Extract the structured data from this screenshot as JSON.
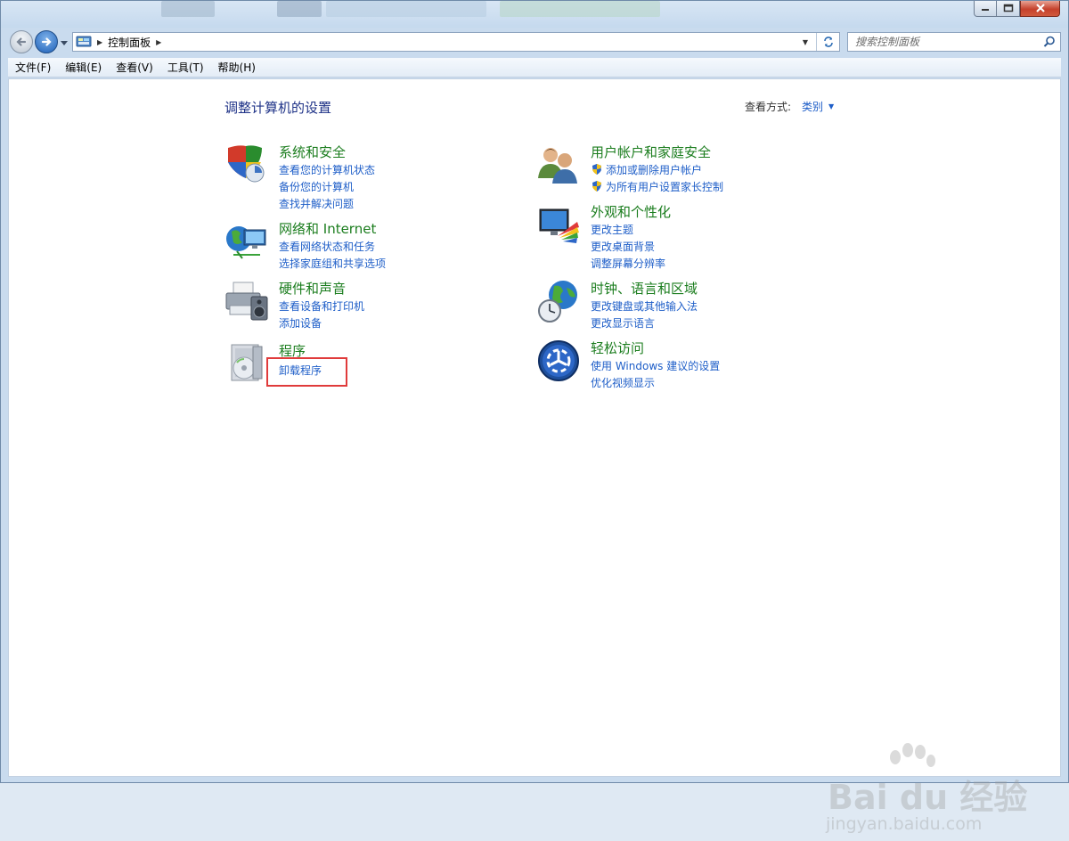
{
  "window": {
    "controls": {
      "minimize": "minimize",
      "maximize": "maximize",
      "close": "close"
    }
  },
  "address": {
    "breadcrumb": [
      "控制面板"
    ]
  },
  "search": {
    "placeholder": "搜索控制面板"
  },
  "menu": {
    "items": [
      "文件(F)",
      "编辑(E)",
      "查看(V)",
      "工具(T)",
      "帮助(H)"
    ]
  },
  "main": {
    "heading": "调整计算机的设置",
    "view_by_label": "查看方式:",
    "view_by_value": "类别",
    "categories": [
      {
        "title": "系统和安全",
        "icon": "shield-security-icon",
        "links": [
          "查看您的计算机状态",
          "备份您的计算机",
          "查找并解决问题"
        ]
      },
      {
        "title": "网络和 Internet",
        "icon": "network-globe-icon",
        "links": [
          "查看网络状态和任务",
          "选择家庭组和共享选项"
        ]
      },
      {
        "title": "硬件和声音",
        "icon": "printer-speaker-icon",
        "links": [
          "查看设备和打印机",
          "添加设备"
        ]
      },
      {
        "title": "程序",
        "icon": "programs-disc-icon",
        "links": [
          "卸载程序"
        ]
      },
      {
        "title": "用户帐户和家庭安全",
        "icon": "users-icon",
        "links": [
          "添加或删除用户帐户",
          "为所有用户设置家长控制"
        ]
      },
      {
        "title": "外观和个性化",
        "icon": "monitor-palette-icon",
        "links": [
          "更改主题",
          "更改桌面背景",
          "调整屏幕分辨率"
        ]
      },
      {
        "title": "时钟、语言和区域",
        "icon": "clock-globe-icon",
        "links": [
          "更改键盘或其他输入法",
          "更改显示语言"
        ]
      },
      {
        "title": "轻松访问",
        "icon": "ease-of-access-icon",
        "links": [
          "使用 Windows 建议的设置",
          "优化视频显示"
        ]
      }
    ]
  },
  "watermark": {
    "logo": "Bai du 经验",
    "url": "jingyan.baidu.com"
  },
  "colors": {
    "category_title": "#1b7d1e",
    "link": "#1e5ec8",
    "heading": "#1e3287",
    "highlight": "#e03b3b"
  }
}
